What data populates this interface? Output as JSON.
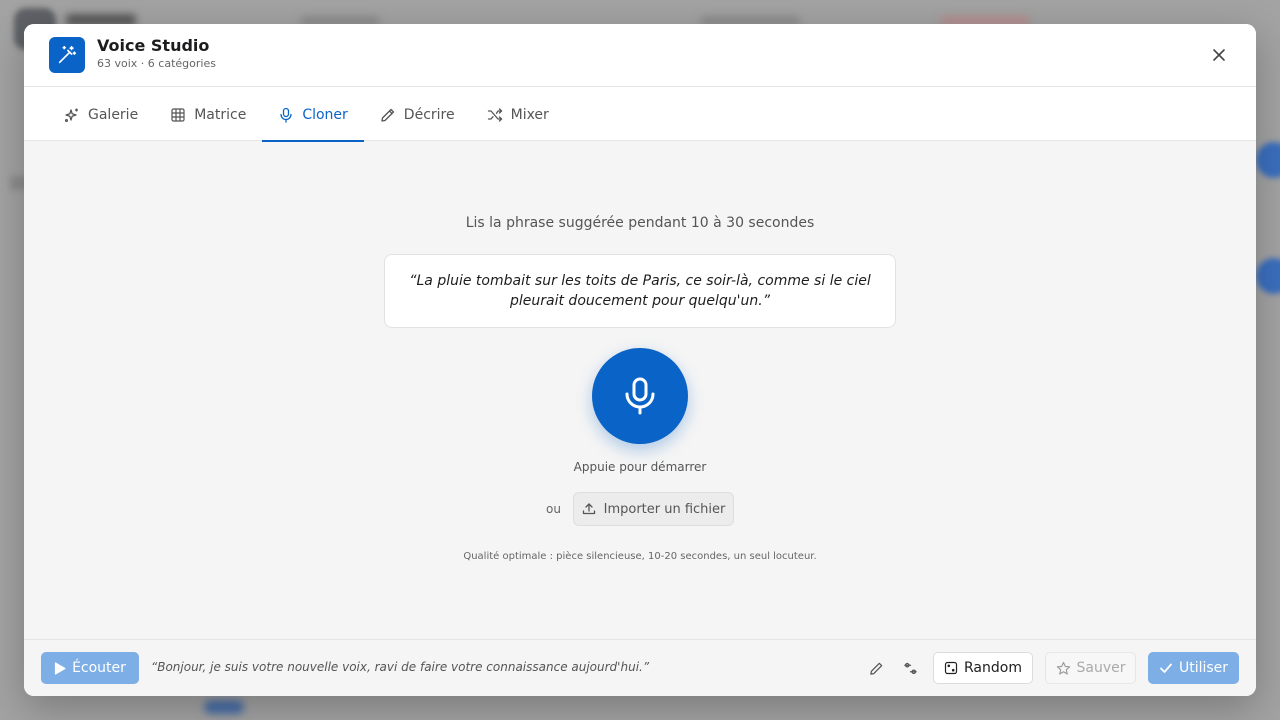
{
  "app": {
    "title": "Voice Studio",
    "subtitle": "63 voix · 6 catégories",
    "icon": "magic-wand-icon",
    "accent_color": "#0a64c8"
  },
  "tabs": [
    {
      "label": "Galerie",
      "icon": "sparkles-icon",
      "active": false
    },
    {
      "label": "Matrice",
      "icon": "grid-icon",
      "active": false
    },
    {
      "label": "Cloner",
      "icon": "mic-icon",
      "active": true
    },
    {
      "label": "Décrire",
      "icon": "pencil-icon",
      "active": false
    },
    {
      "label": "Mixer",
      "icon": "shuffle-icon",
      "active": false
    }
  ],
  "clone": {
    "instruction": "Lis la phrase suggérée pendant 10 à 30 secondes",
    "suggested_sentence": "“La pluie tombait sur les toits de Paris, ce soir-là, comme si le ciel pleurait doucement pour quelqu'un.”",
    "mic_hint": "Appuie pour démarrer",
    "or_label": "ou",
    "import_label": "Importer un fichier",
    "quality_note": "Qualité optimale : pièce silencieuse, 10-20 secondes, un seul locuteur."
  },
  "footer": {
    "listen_label": "Écouter",
    "preview_text": "“Bonjour, je suis votre nouvelle voix, ravi de faire votre connaissance aujourd'hui.”",
    "random_label": "Random",
    "save_label": "Sauver",
    "use_label": "Utiliser"
  }
}
